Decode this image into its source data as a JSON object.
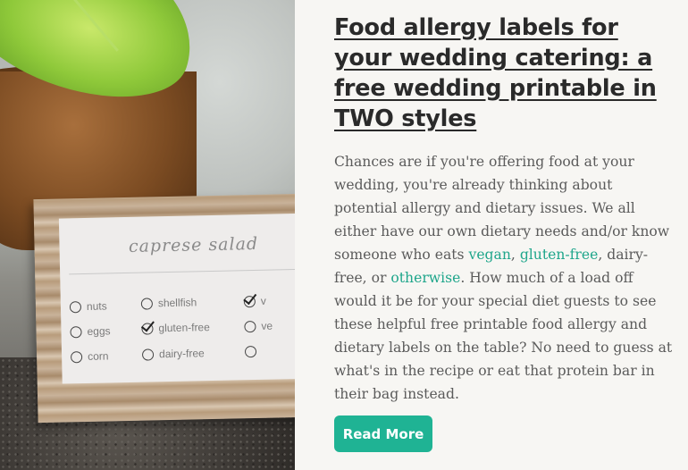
{
  "article": {
    "title": "Food allergy labels for your wedding catering: a free wedding printable in TWO styles",
    "excerpt_parts": {
      "p1": "Chances are if you're offering food at your wedding, you're already thinking about potential allergy and dietary issues. We all either have our own dietary needs and/or know someone who eats ",
      "link_vegan": "vegan",
      "p2": ", ",
      "link_gluten_free": "gluten-free",
      "p3": ", dairy-free, or ",
      "link_otherwise": "otherwise",
      "p4": ". How much of a load off would it be for your special diet guests to see these helpful free printable food allergy and dietary labels on the table? No need to guess at what's in the recipe or eat that protein bar in their bag instead."
    },
    "read_more_label": "Read More"
  },
  "photo_card": {
    "title": "caprese salad",
    "options": {
      "nuts": "nuts",
      "shellfish": "shellfish",
      "v_top": "v",
      "eggs": "eggs",
      "gluten_free": "gluten-free",
      "v_mid": "ve",
      "corn": "corn",
      "dairy_free": "dairy-free"
    }
  },
  "colors": {
    "accent": "#1fb394",
    "link": "#1fa68b",
    "title": "#2a2a2a",
    "body_text": "#5b5b5b",
    "background": "#f7f6f3"
  }
}
